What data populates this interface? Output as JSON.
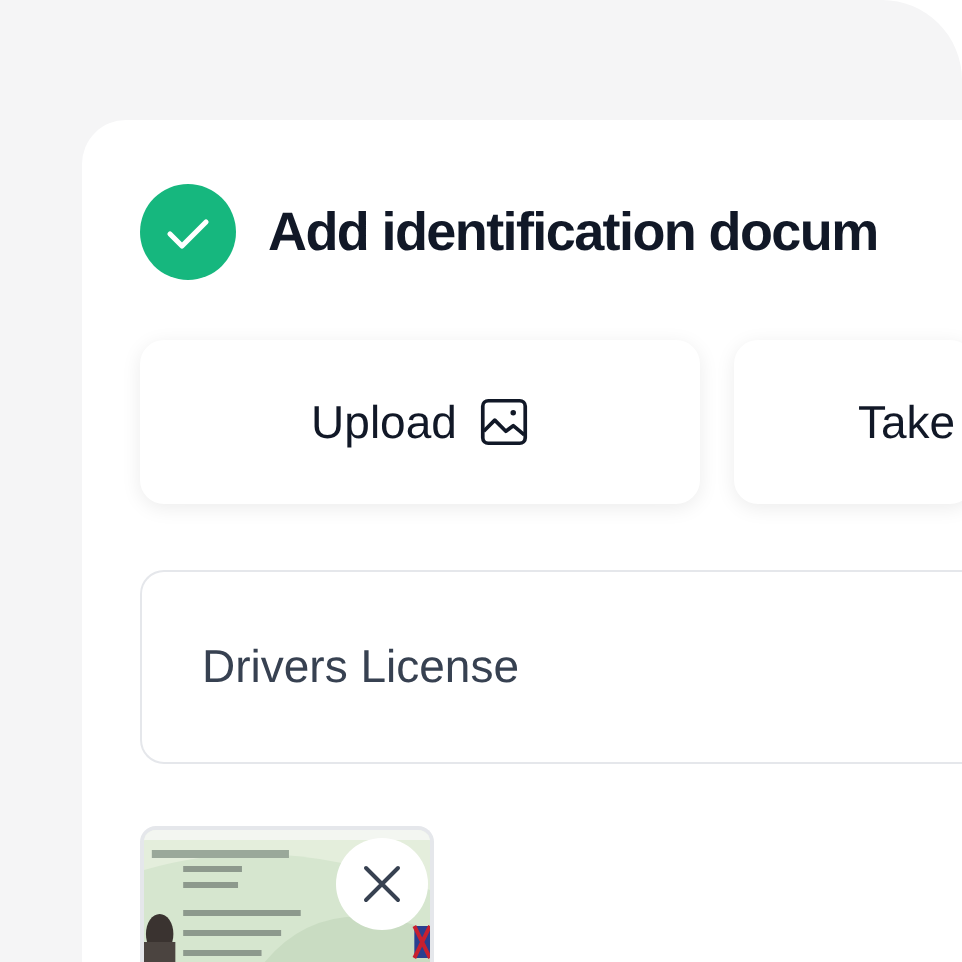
{
  "header": {
    "title": "Add identification docum",
    "done": true
  },
  "actions": [
    {
      "label": "Upload",
      "kind": "upload"
    },
    {
      "label": "Take",
      "kind": "take"
    }
  ],
  "document_type": {
    "value": "Drivers License"
  }
}
